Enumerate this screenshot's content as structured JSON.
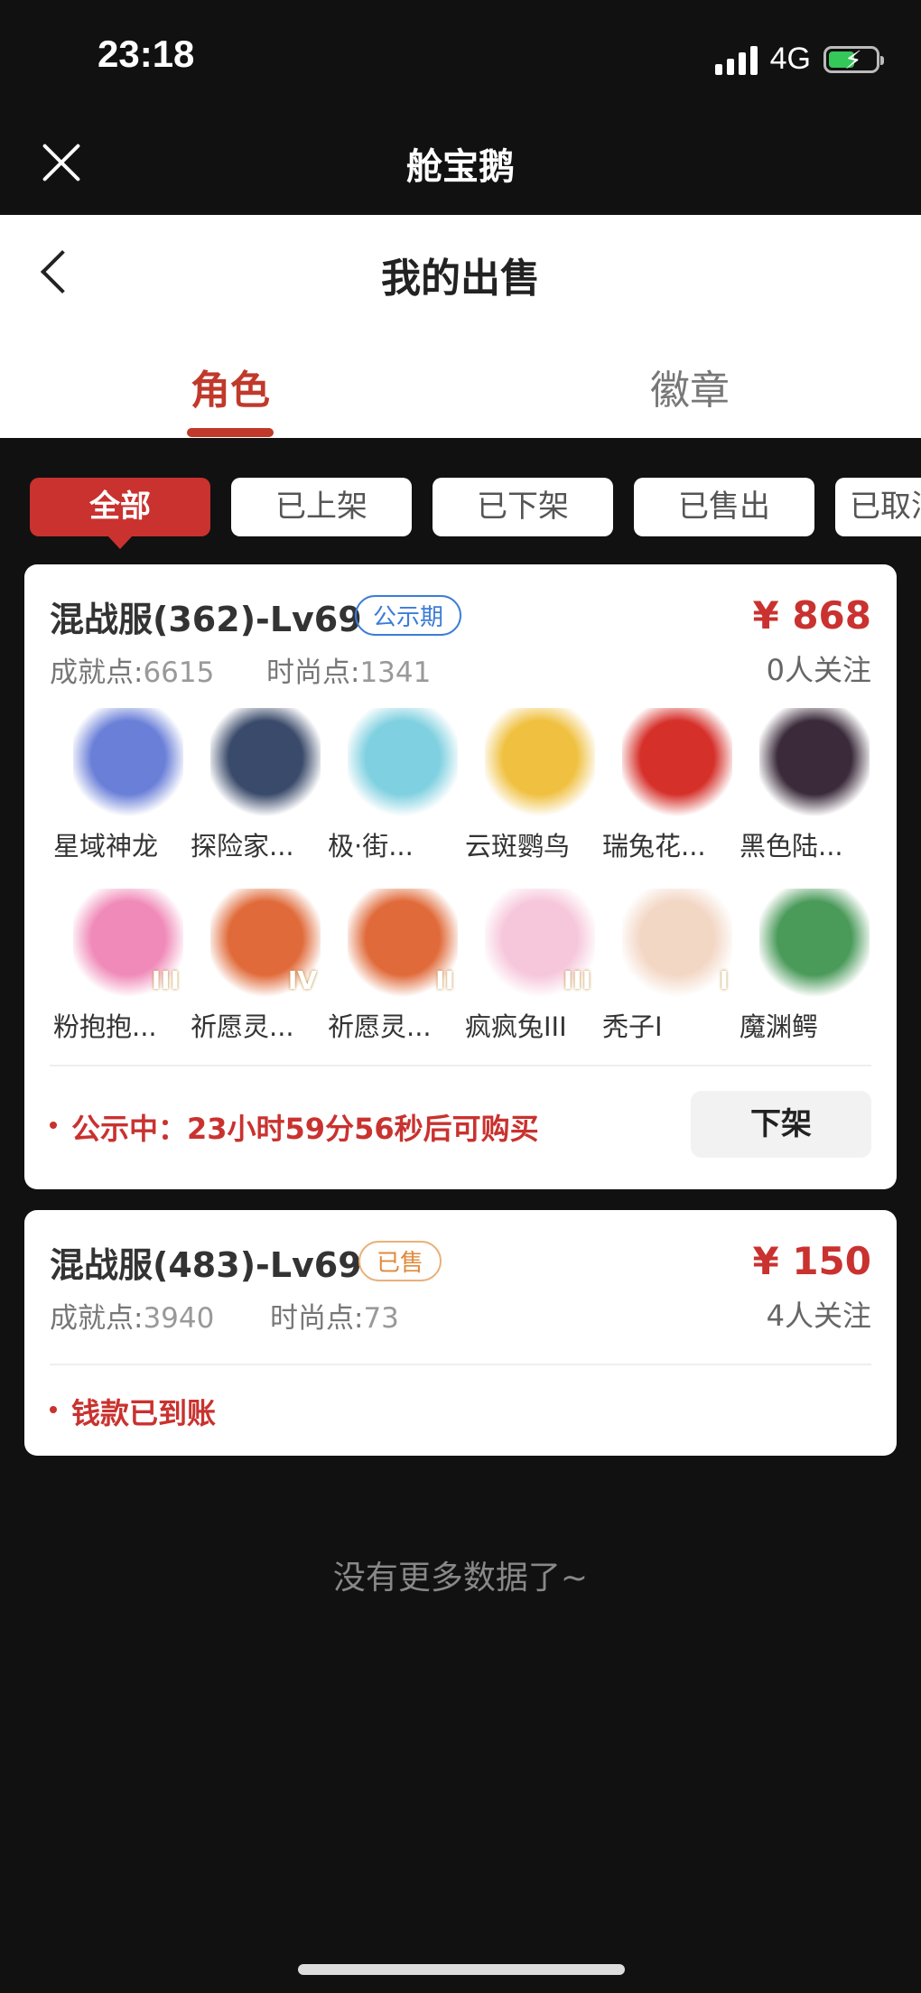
{
  "status_bar": {
    "time": "23:18",
    "network": "4G"
  },
  "miniapp": {
    "title": "舱宝鹅"
  },
  "header": {
    "title": "我的出售"
  },
  "tabs": [
    {
      "label": "角色",
      "active": true
    },
    {
      "label": "徽章",
      "active": false
    }
  ],
  "filters": [
    {
      "label": "全部",
      "active": true
    },
    {
      "label": "已上架",
      "active": false
    },
    {
      "label": "已下架",
      "active": false
    },
    {
      "label": "已售出",
      "active": false
    },
    {
      "label": "已取消",
      "active": false
    }
  ],
  "listings": [
    {
      "title": "混战服(362)-Lv69",
      "badge": "公示期",
      "price": "¥ 868",
      "watchers": "0人关注",
      "achievement_label": "成就点:",
      "achievement_value": "6615",
      "fashion_label": "时尚点:",
      "fashion_value": "1341",
      "items": [
        {
          "name": "星域神龙",
          "icon": "dragon-icon",
          "color": "#6a7fd8",
          "tier": ""
        },
        {
          "name": "探险家...",
          "icon": "shovel-icon",
          "color": "#3a4a6a",
          "tier": ""
        },
        {
          "name": "极·街...",
          "icon": "skateboard-icon",
          "color": "#7fd0e0",
          "tier": ""
        },
        {
          "name": "云斑鹦鸟",
          "icon": "parrot-icon",
          "color": "#f0c040",
          "tier": ""
        },
        {
          "name": "瑞兔花...",
          "icon": "cake-icon",
          "color": "#d6302a",
          "tier": ""
        },
        {
          "name": "黑色陆...",
          "icon": "dino-icon",
          "color": "#3a2a3a",
          "tier": ""
        },
        {
          "name": "粉抱抱...",
          "icon": "bear-icon",
          "color": "#f08ab8",
          "tier": "III"
        },
        {
          "name": "祈愿灵...",
          "icon": "griffin-icon",
          "color": "#e06a3a",
          "tier": "IV"
        },
        {
          "name": "祈愿灵...",
          "icon": "griffin-icon",
          "color": "#e06a3a",
          "tier": "II"
        },
        {
          "name": "疯疯兔III",
          "icon": "rabbit-icon",
          "color": "#f6c6da",
          "tier": "III"
        },
        {
          "name": "秃子I",
          "icon": "bald-head-icon",
          "color": "#f3d7c5",
          "tier": "I"
        },
        {
          "name": "魔渊鳄",
          "icon": "crocodile-icon",
          "color": "#4a9a5a",
          "tier": ""
        }
      ],
      "notice": "公示中：23小时59分56秒后可购买",
      "action": "下架"
    },
    {
      "title": "混战服(483)-Lv69",
      "badge": "已售",
      "price": "¥ 150",
      "watchers": "4人关注",
      "achievement_label": "成就点:",
      "achievement_value": "3940",
      "fashion_label": "时尚点:",
      "fashion_value": "73",
      "notice": "钱款已到账"
    }
  ],
  "footer": {
    "no_more": "没有更多数据了~"
  },
  "colors": {
    "accent": "#c9322f",
    "badge_blue": "#3b7dd8",
    "badge_orange": "#e08a3c"
  }
}
